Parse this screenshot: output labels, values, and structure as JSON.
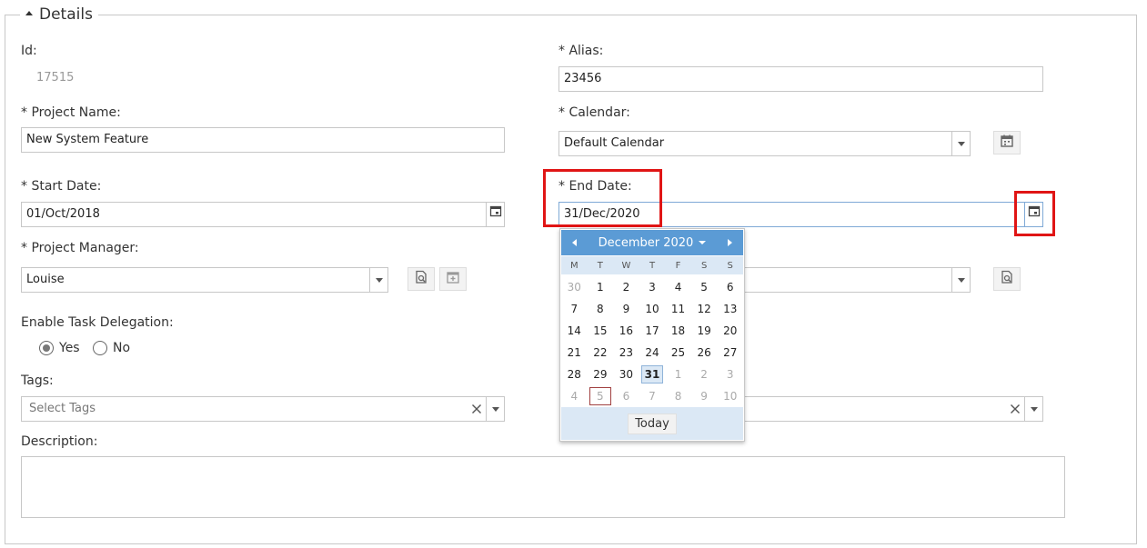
{
  "section": {
    "title": "Details"
  },
  "fields": {
    "id": {
      "label": "Id:",
      "value": "17515"
    },
    "alias": {
      "label": "* Alias:",
      "value": "23456"
    },
    "project_name": {
      "label": "* Project Name:",
      "value": "New System Feature"
    },
    "calendar": {
      "label": "* Calendar:",
      "value": "Default Calendar"
    },
    "start_date": {
      "label": "* Start Date:",
      "value": "01/Oct/2018"
    },
    "end_date": {
      "label": "* End Date:",
      "value": "31/Dec/2020"
    },
    "project_manager": {
      "label": "* Project Manager:",
      "value": "Louise"
    },
    "task_delegation": {
      "label": "Enable Task Delegation:",
      "options": [
        "Yes",
        "No"
      ],
      "selected": "Yes"
    },
    "tags": {
      "label": "Tags:",
      "placeholder": "Select Tags"
    },
    "description": {
      "label": "Description:",
      "value": ""
    }
  },
  "datepicker": {
    "month_label": "December 2020",
    "weekdays": [
      "M",
      "T",
      "W",
      "T",
      "F",
      "S",
      "S"
    ],
    "weeks": [
      [
        "30",
        "1",
        "2",
        "3",
        "4",
        "5",
        "6"
      ],
      [
        "7",
        "8",
        "9",
        "10",
        "11",
        "12",
        "13"
      ],
      [
        "14",
        "15",
        "16",
        "17",
        "18",
        "19",
        "20"
      ],
      [
        "21",
        "22",
        "23",
        "24",
        "25",
        "26",
        "27"
      ],
      [
        "28",
        "29",
        "30",
        "31",
        "1",
        "2",
        "3"
      ],
      [
        "4",
        "5",
        "6",
        "7",
        "8",
        "9",
        "10"
      ]
    ],
    "selected_day": "31",
    "today_day": "5",
    "today_label": "Today"
  },
  "icons": {
    "calendar": "calendar-icon",
    "lookup": "search-document-icon",
    "add": "add-calendar-icon",
    "clear": "clear-icon"
  },
  "colors": {
    "highlight": "#e01515",
    "calendar_header": "#5b9bd5"
  }
}
